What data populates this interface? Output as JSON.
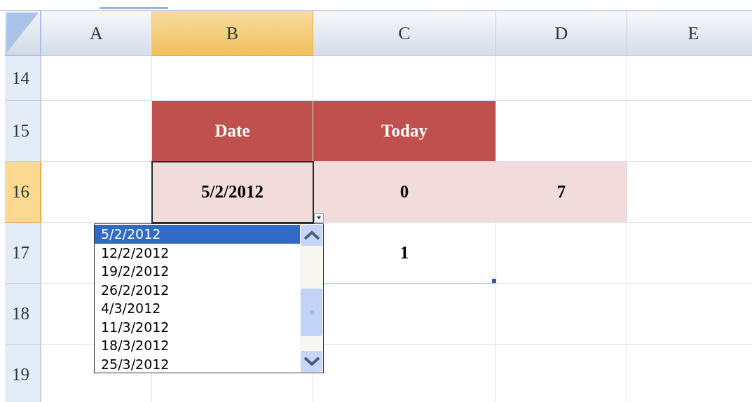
{
  "columns": [
    {
      "label": "A",
      "selected": false
    },
    {
      "label": "B",
      "selected": true
    },
    {
      "label": "C",
      "selected": false
    },
    {
      "label": "D",
      "selected": false
    },
    {
      "label": "E",
      "selected": false
    }
  ],
  "rows": [
    {
      "label": "14",
      "selected": false,
      "cells": [
        {
          "kind": "plain"
        },
        {
          "kind": "plain"
        },
        {
          "kind": "plain"
        },
        {
          "kind": "plain"
        },
        {
          "kind": "plain"
        }
      ]
    },
    {
      "label": "15",
      "selected": false,
      "cells": [
        {
          "kind": "plain"
        },
        {
          "kind": "header",
          "text": "Date"
        },
        {
          "kind": "header",
          "text": "Today"
        },
        {
          "kind": "plain"
        },
        {
          "kind": "plain"
        }
      ]
    },
    {
      "label": "16",
      "selected": true,
      "cells": [
        {
          "kind": "plain"
        },
        {
          "kind": "band",
          "text": "5/2/2012",
          "active": true
        },
        {
          "kind": "band",
          "text": "0"
        },
        {
          "kind": "band",
          "text": "7"
        },
        {
          "kind": "plain"
        }
      ]
    },
    {
      "label": "17",
      "selected": false,
      "cells": [
        {
          "kind": "plain"
        },
        {
          "kind": "plain"
        },
        {
          "kind": "outlined",
          "text": "1",
          "handle": true
        },
        {
          "kind": "plain"
        },
        {
          "kind": "plain"
        }
      ]
    },
    {
      "label": "18",
      "selected": false,
      "cells": [
        {
          "kind": "plain"
        },
        {
          "kind": "plain"
        },
        {
          "kind": "plain"
        },
        {
          "kind": "plain"
        },
        {
          "kind": "plain"
        }
      ]
    },
    {
      "label": "19",
      "selected": false,
      "cells": [
        {
          "kind": "plain"
        },
        {
          "kind": "plain"
        },
        {
          "kind": "plain"
        },
        {
          "kind": "plain"
        },
        {
          "kind": "plain"
        }
      ]
    }
  ],
  "dropdown": {
    "items": [
      {
        "text": "5/2/2012",
        "selected": true
      },
      {
        "text": "12/2/2012",
        "selected": false
      },
      {
        "text": "19/2/2012",
        "selected": false
      },
      {
        "text": "26/2/2012",
        "selected": false
      },
      {
        "text": "4/3/2012",
        "selected": false
      },
      {
        "text": "11/3/2012",
        "selected": false
      },
      {
        "text": "18/3/2012",
        "selected": false
      },
      {
        "text": "25/3/2012",
        "selected": false
      }
    ]
  }
}
